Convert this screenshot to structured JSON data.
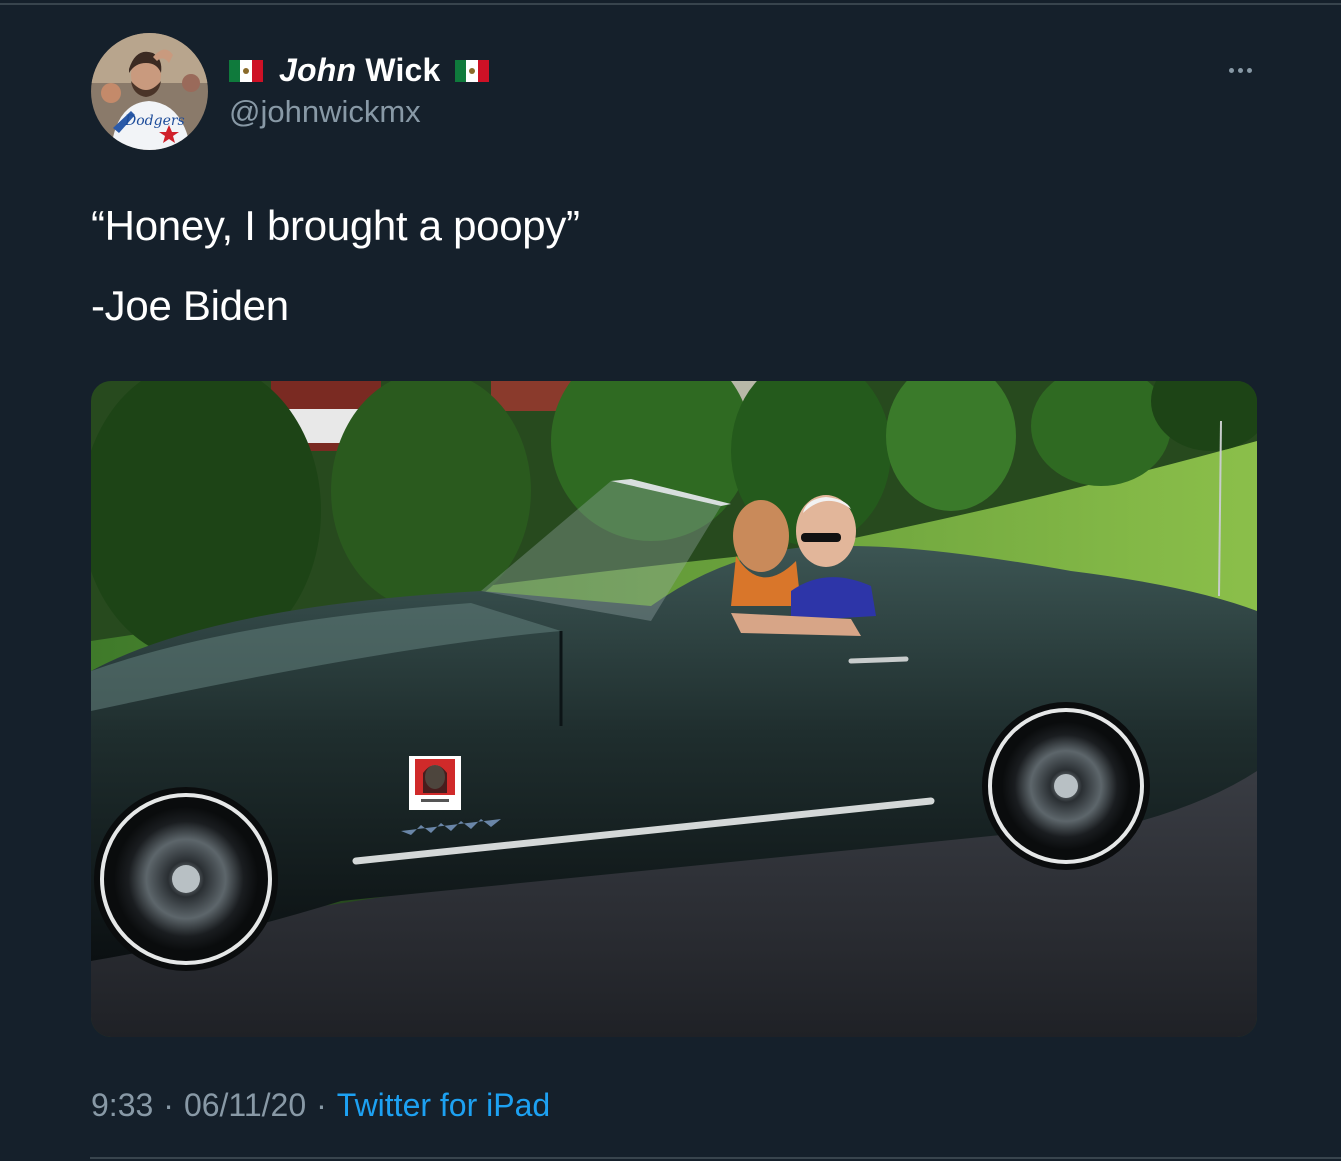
{
  "tweet": {
    "author": {
      "display_name_first": "John",
      "display_name_last": "Wick",
      "handle": "@johnwickmx",
      "flag_icon": "mexico-flag-icon",
      "avatar_icon": "profile-avatar"
    },
    "text_lines": [
      "“Honey, I brought a poopy”",
      "-Joe Biden"
    ],
    "media": {
      "kind": "photo",
      "sticker_icon": "john-wick-sticker-icon"
    },
    "time": "9:33",
    "separator": "·",
    "date": "06/11/20",
    "source": "Twitter for iPad"
  },
  "colors": {
    "background": "#15202b",
    "secondary_text": "#8899a6",
    "link": "#1da1f2",
    "divider": "#38444d"
  }
}
